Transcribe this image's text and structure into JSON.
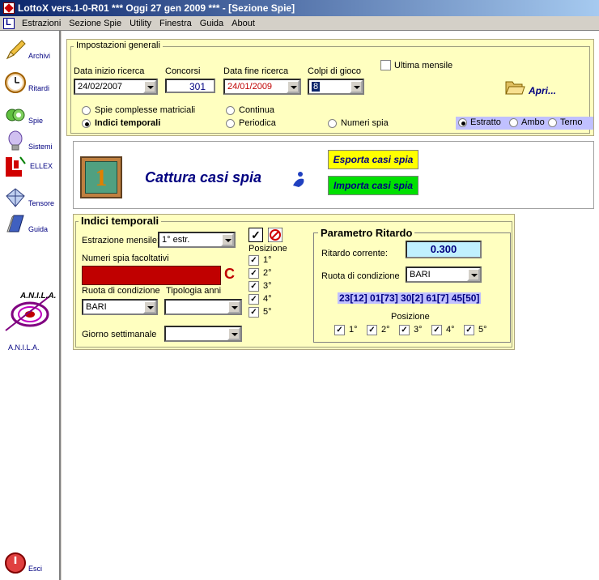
{
  "window": {
    "title": "LottoX vers.1-0-R01  ***  Oggi 27 gen 2009  ***   - [Sezione Spie]"
  },
  "menu": {
    "items": [
      "Estrazioni",
      "Sezione Spie",
      "Utility",
      "Finestra",
      "Guida",
      "About"
    ]
  },
  "sidebar": {
    "items": [
      {
        "label": "Archivi",
        "icon": "pencil-icon"
      },
      {
        "label": "Ritardi",
        "icon": "clock-icon"
      },
      {
        "label": "Spie",
        "icon": "eye-icon"
      },
      {
        "label": "Sistemi",
        "icon": "lightbulb-icon"
      },
      {
        "label": "ELLEX",
        "icon": "ellex-logo-icon"
      },
      {
        "label": "Tensore",
        "icon": "diamond-icon"
      },
      {
        "label": "Guida",
        "icon": "book-icon"
      }
    ],
    "anila_logo_text": "A.N.I.L.A.",
    "anila_label": "A.N.I.L.A.",
    "exit_label": "Esci"
  },
  "impostazioni": {
    "legend": "Impostazioni generali",
    "data_inizio_label": "Data inizio ricerca",
    "data_inizio_value": "24/02/2007",
    "concorsi_label": "Concorsi",
    "concorsi_value": "301",
    "data_fine_label": "Data fine ricerca",
    "data_fine_value": "24/01/2009",
    "colpi_label": "Colpi di gioco",
    "colpi_value": "8",
    "ultima_mensile_label": "Ultima mensile",
    "apri_label": "Apri...",
    "radio_spie_complesse": "Spie complesse matriciali",
    "radio_indici": "Indici temporali",
    "radio_continua": "Continua",
    "radio_periodica": "Periodica",
    "radio_numeri_spia": "Numeri spia",
    "radio_estratto": "Estratto",
    "radio_ambo": "Ambo",
    "radio_terno": "Terno"
  },
  "cattura": {
    "badge_number": "1",
    "title": "Cattura casi spia",
    "esporta_label": "Esporta casi spia",
    "importa_label": "Importa casi spia"
  },
  "indici": {
    "legend": "Indici temporali",
    "estrazione_label": "Estrazione mensile:",
    "estrazione_value": "1° estr.",
    "numeri_spia_label": "Numeri spia facoltativi",
    "clear_letter": "C",
    "ruota_label": "Ruota di condizione",
    "ruota_value": "BARI",
    "tipologia_label": "Tipologia anni",
    "giorno_label": "Giorno settimanale",
    "check_all": "✓",
    "posizione_label": "Posizione",
    "positions": [
      "1°",
      "2°",
      "3°",
      "4°",
      "5°"
    ]
  },
  "parametro": {
    "legend": "Parametro Ritardo",
    "ritardo_label": "Ritardo corrente:",
    "ritardo_value": "0.300",
    "ruota_label": "Ruota di condizione",
    "ruota_value": "BARI",
    "estrazione_values": "23[12] 01[73] 30[2] 61[7] 45[50]",
    "posizione_label": "Posizione",
    "positions": [
      "1°",
      "2°",
      "3°",
      "4°",
      "5°"
    ]
  },
  "colors": {
    "panel_bg": "#ffffc0",
    "esporta_bg": "#ffff00",
    "importa_bg": "#00e000",
    "numeri_spia_bg": "#c00000",
    "ritardo_bg": "#c0f0ff",
    "title_bg": "#0a246a"
  }
}
